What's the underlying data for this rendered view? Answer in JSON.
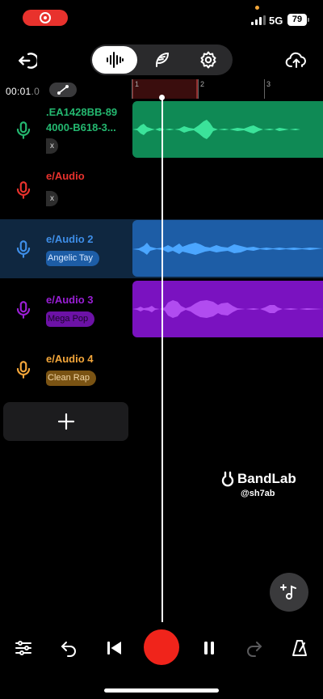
{
  "status_bar": {
    "network": "5G",
    "battery": "79"
  },
  "toolbar": {
    "back_icon": "exit-icon",
    "modes": [
      "waveform-icon",
      "feather-icon",
      "gear-icon"
    ],
    "upload_icon": "cloud-upload-icon"
  },
  "timeline": {
    "time_main": "00:01",
    "time_ms": ".0",
    "bar_numbers": [
      "1",
      "2",
      "3"
    ]
  },
  "tracks": [
    {
      "name_line1": ".EA1428BB-89",
      "name_line2": "4000-B618-3...",
      "preset": "",
      "chip": "x",
      "color": "#24b870",
      "region_color": "#0f8a55",
      "wave_color": "#3be39a",
      "selected": false
    },
    {
      "name_line1": "e/Audio",
      "preset": "",
      "chip": "x",
      "color": "#e8322d",
      "selected": false
    },
    {
      "name_line1": "e/Audio 2",
      "preset": "Angelic Tay",
      "chip": "",
      "color": "#3e8ee8",
      "region_color": "#1d5da6",
      "wave_color": "#4ba6ff",
      "preset_bg": "#1d5da6",
      "selected": true
    },
    {
      "name_line1": "e/Audio 3",
      "preset": "Mega Pop",
      "chip": "",
      "color": "#9a1fd6",
      "region_color": "#7a12c0",
      "wave_color": "#b14cf0",
      "preset_bg": "#6c12a6",
      "selected": false
    },
    {
      "name_line1": "e/Audio 4",
      "preset": "Clean Rap",
      "chip": "",
      "color": "#f3a63a",
      "preset_bg": "#7a5313",
      "selected": false
    }
  ],
  "add_track_icon": "plus-icon",
  "watermark": {
    "brand": "BandLab",
    "handle": "@sh7ab"
  },
  "transport": {
    "icons": [
      "mixer-icon",
      "undo-icon",
      "skip-back-icon",
      "record-icon",
      "pause-icon",
      "redo-icon",
      "metronome-icon"
    ]
  }
}
